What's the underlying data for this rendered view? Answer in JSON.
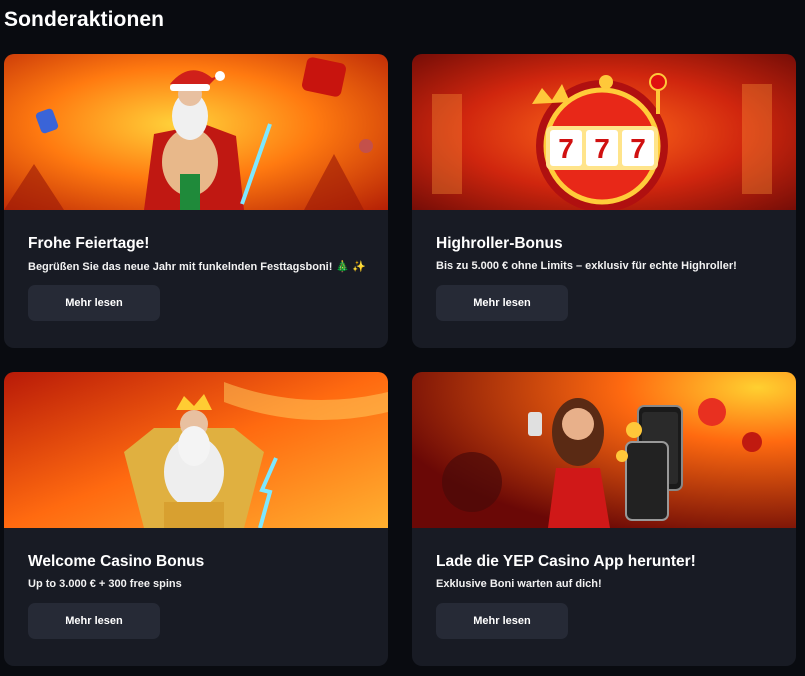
{
  "section": {
    "title": "Sonderaktionen"
  },
  "promotions": [
    {
      "title": "Frohe Feiertage!",
      "description": "Begrüßen Sie das neue Jahr mit funkelnden Festtagsboni! 🎄 ✨",
      "button_label": "Mehr lesen",
      "image": "santa-zeus-banner"
    },
    {
      "title": "Highroller-Bonus",
      "description": "Bis zu 5.000 € ohne Limits – exklusiv für echte Highroller!",
      "button_label": "Mehr lesen",
      "image": "slot-machine-777-banner"
    },
    {
      "title": "Welcome Casino Bonus",
      "description": "Up to 3.000 € + 300 free spins",
      "button_label": "Mehr lesen",
      "image": "zeus-lightning-banner"
    },
    {
      "title": "Lade die YEP Casino App herunter!",
      "description": "Exklusive Boni warten auf dich!",
      "button_label": "Mehr lesen",
      "image": "mobile-app-woman-banner"
    }
  ],
  "colors": {
    "background": "#090b10",
    "card": "#181b24",
    "button": "#262a36",
    "text": "#ffffff"
  }
}
